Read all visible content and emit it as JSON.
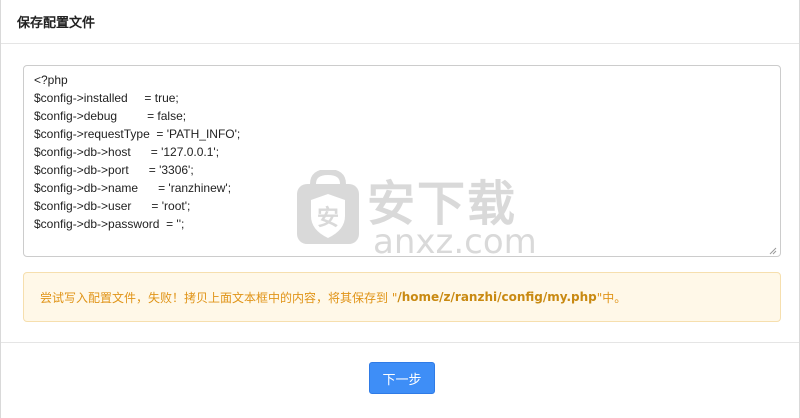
{
  "dialog": {
    "title": "保存配置文件"
  },
  "config": {
    "content": "<?php\n$config->installed     = true;\n$config->debug         = false;\n$config->requestType  = 'PATH_INFO';\n$config->db->host      = '127.0.0.1';\n$config->db->port      = '3306';\n$config->db->name      = 'ranzhinew';\n$config->db->user      = 'root';\n$config->db->password  = '';"
  },
  "watermark": {
    "cn_text": "安下载",
    "en_text": "anxz.com"
  },
  "alert": {
    "prefix": "尝试写入配置文件，失败！拷贝上面文本框中的内容，将其保存到 \" ",
    "path": "/home/z/ranzhi/config/my.php",
    "suffix": " \"中。"
  },
  "footer": {
    "next_label": "下一步"
  },
  "colors": {
    "primary": "#3e8ef7",
    "warning_text": "#e09418",
    "warning_bg": "#fff8e8"
  }
}
